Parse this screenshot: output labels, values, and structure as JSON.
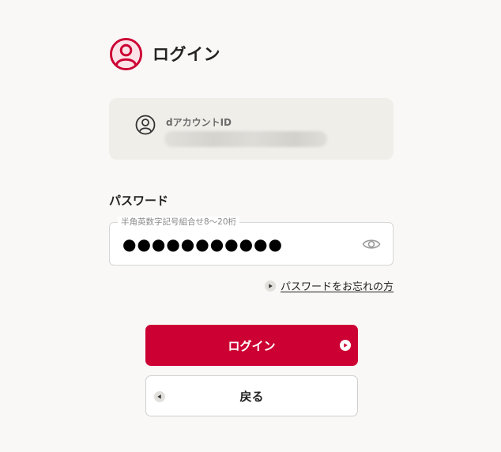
{
  "header": {
    "title": "ログイン",
    "icon": "user-circle-icon",
    "accent_color": "#cc0033"
  },
  "account": {
    "label": "dアカウントID",
    "value": "",
    "icon": "user-circle-icon"
  },
  "password": {
    "heading": "パスワード",
    "placeholder": "半角英数字記号組合せ8〜20桁",
    "value": "●●●●●●●●●●●",
    "toggle_icon": "eye-icon"
  },
  "forgot": {
    "label": "パスワードをお忘れの方",
    "icon": "play-circle-icon"
  },
  "buttons": {
    "login_label": "ログイン",
    "login_color": "#cc0033",
    "back_label": "戻る"
  }
}
